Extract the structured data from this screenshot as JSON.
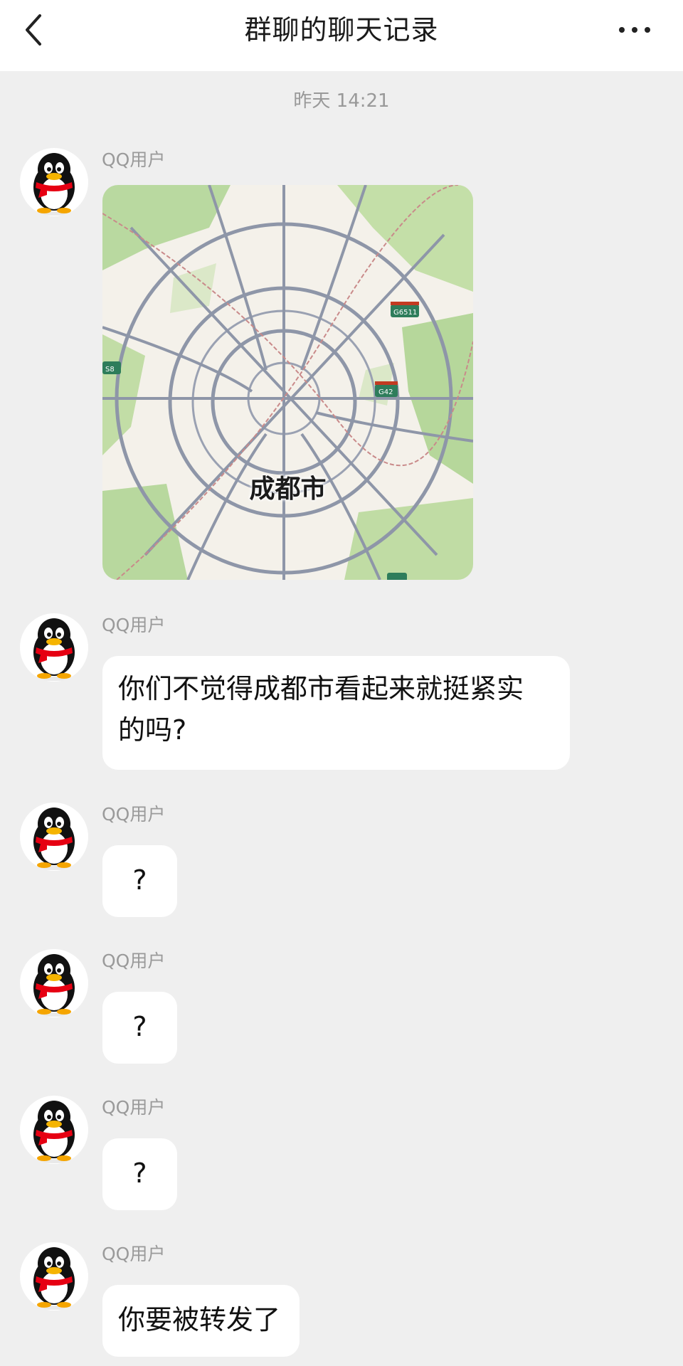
{
  "header": {
    "title": "群聊的聊天记录",
    "back_icon": "chevron-left-icon",
    "more_icon": "more-dots-icon"
  },
  "timestamp": "昨天 14:21",
  "colors": {
    "background": "#efefef",
    "bubble": "#ffffff",
    "meta_text": "#999999"
  },
  "messages": [
    {
      "sender": "QQ用户",
      "type": "image",
      "image": {
        "kind": "map",
        "place_label": "成都市",
        "road_shields": [
          "G6511",
          "S8",
          "G42"
        ]
      }
    },
    {
      "sender": "QQ用户",
      "type": "text",
      "text_line1": "你们不觉得成都市看起来就挺紧实",
      "text_line2": "的吗?"
    },
    {
      "sender": "QQ用户",
      "type": "text",
      "text": "?"
    },
    {
      "sender": "QQ用户",
      "type": "text",
      "text": "?"
    },
    {
      "sender": "QQ用户",
      "type": "text",
      "text": "?"
    },
    {
      "sender": "QQ用户",
      "type": "text",
      "text": "你要被转发了"
    }
  ]
}
